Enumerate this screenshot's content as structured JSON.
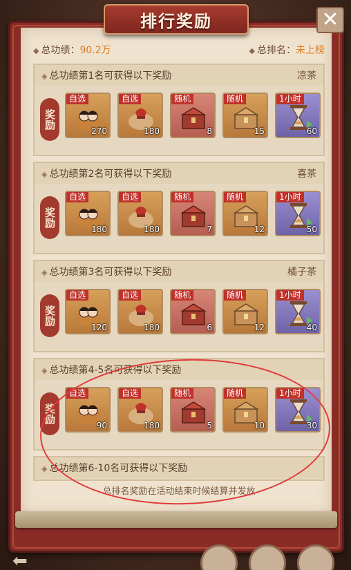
{
  "window": {
    "title": "排行奖励"
  },
  "summary": {
    "total_label": "总功绩：",
    "total_value": "90.2万",
    "rank_label": "总排名：",
    "rank_value": "未上榜"
  },
  "reward_badge": "奖励",
  "sections": [
    {
      "header": "总功绩第1名可获得以下奖励",
      "title_reward": "凉茶",
      "items": [
        {
          "tag": "自选",
          "count": "270",
          "icon": "couple-gift-bag-icon",
          "color": "gold"
        },
        {
          "tag": "自选",
          "count": "180",
          "icon": "gift-bag-icon",
          "color": "gold"
        },
        {
          "tag": "随机",
          "count": "8",
          "icon": "red-chest-icon",
          "color": "red"
        },
        {
          "tag": "随机",
          "count": "15",
          "icon": "gold-chest-icon",
          "color": "gold"
        },
        {
          "tag": "1小时",
          "count": "60",
          "icon": "hourglass-icon",
          "color": "purple"
        }
      ]
    },
    {
      "header": "总功绩第2名可获得以下奖励",
      "title_reward": "喜茶",
      "items": [
        {
          "tag": "自选",
          "count": "180",
          "icon": "couple-gift-bag-icon",
          "color": "gold"
        },
        {
          "tag": "自选",
          "count": "180",
          "icon": "gift-bag-icon",
          "color": "gold"
        },
        {
          "tag": "随机",
          "count": "7",
          "icon": "red-chest-icon",
          "color": "red"
        },
        {
          "tag": "随机",
          "count": "12",
          "icon": "gold-chest-icon",
          "color": "gold"
        },
        {
          "tag": "1小时",
          "count": "50",
          "icon": "hourglass-icon",
          "color": "purple"
        }
      ]
    },
    {
      "header": "总功绩第3名可获得以下奖励",
      "title_reward": "橘子茶",
      "items": [
        {
          "tag": "自选",
          "count": "120",
          "icon": "couple-gift-bag-icon",
          "color": "gold"
        },
        {
          "tag": "自选",
          "count": "180",
          "icon": "gift-bag-icon",
          "color": "gold"
        },
        {
          "tag": "随机",
          "count": "6",
          "icon": "red-chest-icon",
          "color": "red"
        },
        {
          "tag": "随机",
          "count": "12",
          "icon": "gold-chest-icon",
          "color": "gold"
        },
        {
          "tag": "1小时",
          "count": "40",
          "icon": "hourglass-icon",
          "color": "purple"
        }
      ]
    },
    {
      "header": "总功绩第4-5名可获得以下奖励",
      "title_reward": "",
      "items": [
        {
          "tag": "自选",
          "count": "90",
          "icon": "couple-gift-bag-icon",
          "color": "gold"
        },
        {
          "tag": "自选",
          "count": "180",
          "icon": "gift-bag-icon",
          "color": "gold"
        },
        {
          "tag": "随机",
          "count": "5",
          "icon": "red-chest-icon",
          "color": "red"
        },
        {
          "tag": "随机",
          "count": "10",
          "icon": "gold-chest-icon",
          "color": "gold"
        },
        {
          "tag": "1小时",
          "count": "30",
          "icon": "hourglass-icon",
          "color": "purple"
        }
      ]
    }
  ],
  "partial_section": {
    "header": "总功绩第6-10名可获得以下奖励"
  },
  "footer_note": "总排名奖励在活动结束时候结算并发放",
  "colors": {
    "accent": "#e07a1a",
    "frame": "#8a2c26",
    "paper": "#efe3cf",
    "annotation": "#e03a3a"
  }
}
